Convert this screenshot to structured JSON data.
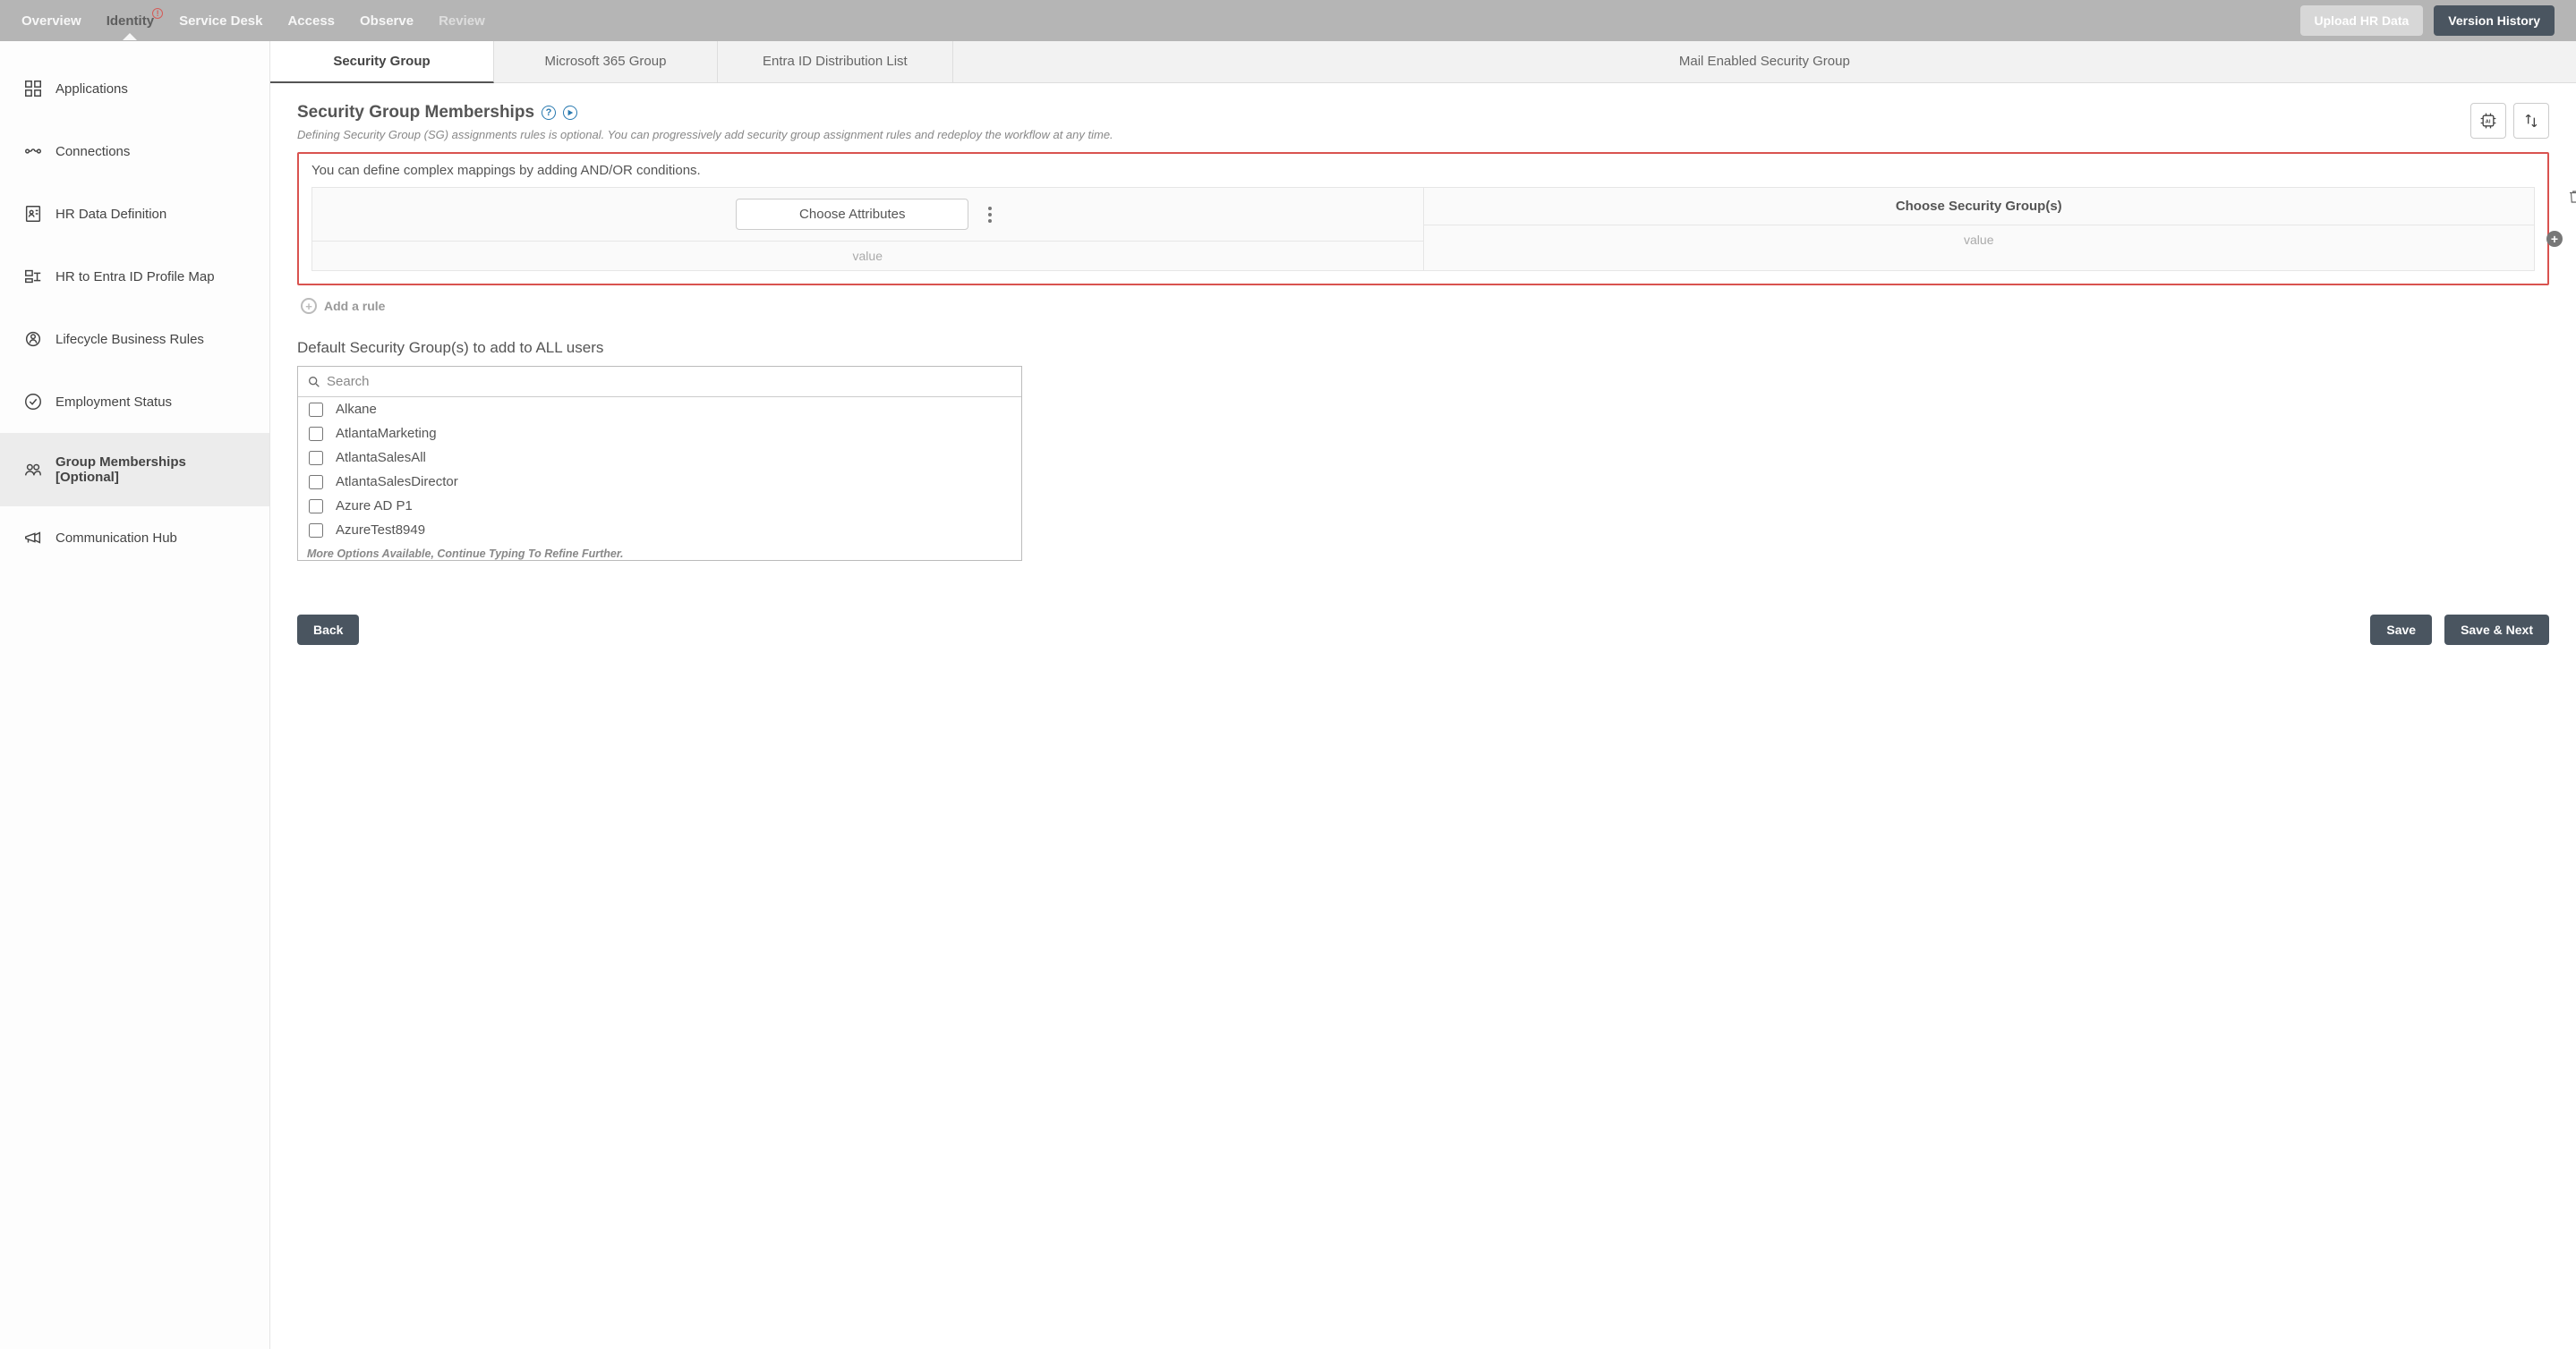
{
  "topbar": {
    "nav": [
      {
        "label": "Overview"
      },
      {
        "label": "Identity",
        "active": true,
        "alert": "!"
      },
      {
        "label": "Service Desk"
      },
      {
        "label": "Access"
      },
      {
        "label": "Observe"
      },
      {
        "label": "Review",
        "faded": true
      }
    ],
    "upload_label": "Upload HR Data",
    "history_label": "Version History"
  },
  "sidebar": {
    "items": [
      {
        "label": "Applications",
        "icon": "apps"
      },
      {
        "label": "Connections",
        "icon": "connections"
      },
      {
        "label": "HR Data Definition",
        "icon": "hr-data"
      },
      {
        "label": "HR to Entra ID Profile Map",
        "icon": "profile-map"
      },
      {
        "label": "Lifecycle Business Rules",
        "icon": "lifecycle"
      },
      {
        "label": "Employment Status",
        "icon": "status"
      },
      {
        "label": "Group Memberships [Optional]",
        "icon": "groups",
        "active": true
      },
      {
        "label": "Communication Hub",
        "icon": "megaphone"
      }
    ]
  },
  "subtabs": [
    {
      "label": "Security Group",
      "active": true
    },
    {
      "label": "Microsoft 365 Group"
    },
    {
      "label": "Entra ID Distribution List"
    },
    {
      "label": "Mail Enabled Security Group"
    }
  ],
  "section": {
    "title": "Security Group Memberships",
    "description": "Defining Security Group (SG) assignments rules is optional. You can progressively add security group assignment rules and redeploy the workflow at any time.",
    "rule_hint": "You can define complex mappings by adding AND/OR conditions.",
    "choose_attributes_label": "Choose Attributes",
    "choose_groups_label": "Choose Security Group(s)",
    "value_placeholder_left": "value",
    "value_placeholder_right": "value",
    "add_rule_label": "Add a rule"
  },
  "default_groups": {
    "heading": "Default Security Group(s) to add to ALL users",
    "search_placeholder": "Search",
    "options": [
      "Alkane",
      "AtlantaMarketing",
      "AtlantaSalesAll",
      "AtlantaSalesDirector",
      "Azure AD P1",
      "AzureTest8949"
    ],
    "more_note": "More Options Available, Continue Typing To Refine Further."
  },
  "footer": {
    "back_label": "Back",
    "save_label": "Save",
    "save_next_label": "Save & Next"
  }
}
